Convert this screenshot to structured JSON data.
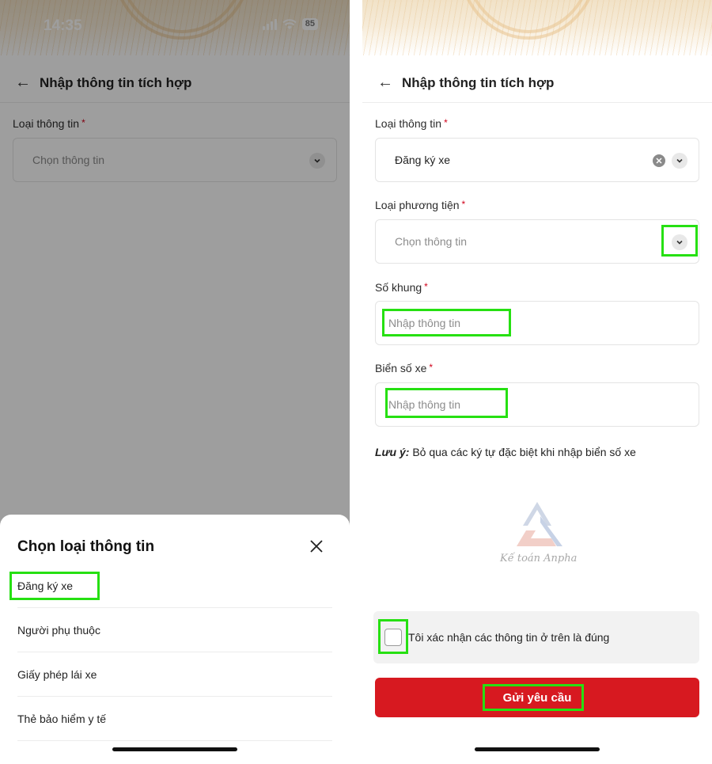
{
  "left_screen": {
    "status": {
      "time": "14:35",
      "battery": "85"
    },
    "header": {
      "title": "Nhập thông tin tích hợp"
    },
    "field": {
      "label": "Loại thông tin",
      "required_mark": "*",
      "placeholder": "Chọn thông tin"
    },
    "sheet": {
      "title": "Chọn loại thông tin",
      "options": [
        "Đăng ký xe",
        "Người phụ thuộc",
        "Giấy phép lái xe",
        "Thẻ bảo hiểm y tế"
      ]
    }
  },
  "right_screen": {
    "header": {
      "title": "Nhập thông tin tích hợp"
    },
    "fields": [
      {
        "label": "Loại thông tin",
        "required_mark": "*",
        "value": "Đăng ký xe"
      },
      {
        "label": "Loại phương tiện",
        "required_mark": "*",
        "placeholder": "Chọn thông tin"
      },
      {
        "label": "Số khung",
        "required_mark": "*",
        "placeholder": "Nhập thông tin"
      },
      {
        "label": "Biển số xe",
        "required_mark": "*",
        "placeholder": "Nhập thông tin"
      }
    ],
    "note": {
      "prefix": "Lưu ý:",
      "text": " Bỏ qua các ký tự đặc biệt khi nhập biển số xe"
    },
    "logo": {
      "text": "Kế toán Anpha"
    },
    "confirm": {
      "label": "Tôi xác nhận các thông tin ở trên là đúng",
      "checked": false
    },
    "submit": {
      "label": "Gửi yêu cầu"
    }
  },
  "colors": {
    "accent_red": "#d71920",
    "highlight": "#26e012",
    "required": "#d0021b"
  },
  "icons": [
    "back-arrow-icon",
    "chevron-down-icon",
    "clear-icon",
    "close-icon",
    "signal-icon",
    "wifi-icon",
    "battery-icon"
  ]
}
